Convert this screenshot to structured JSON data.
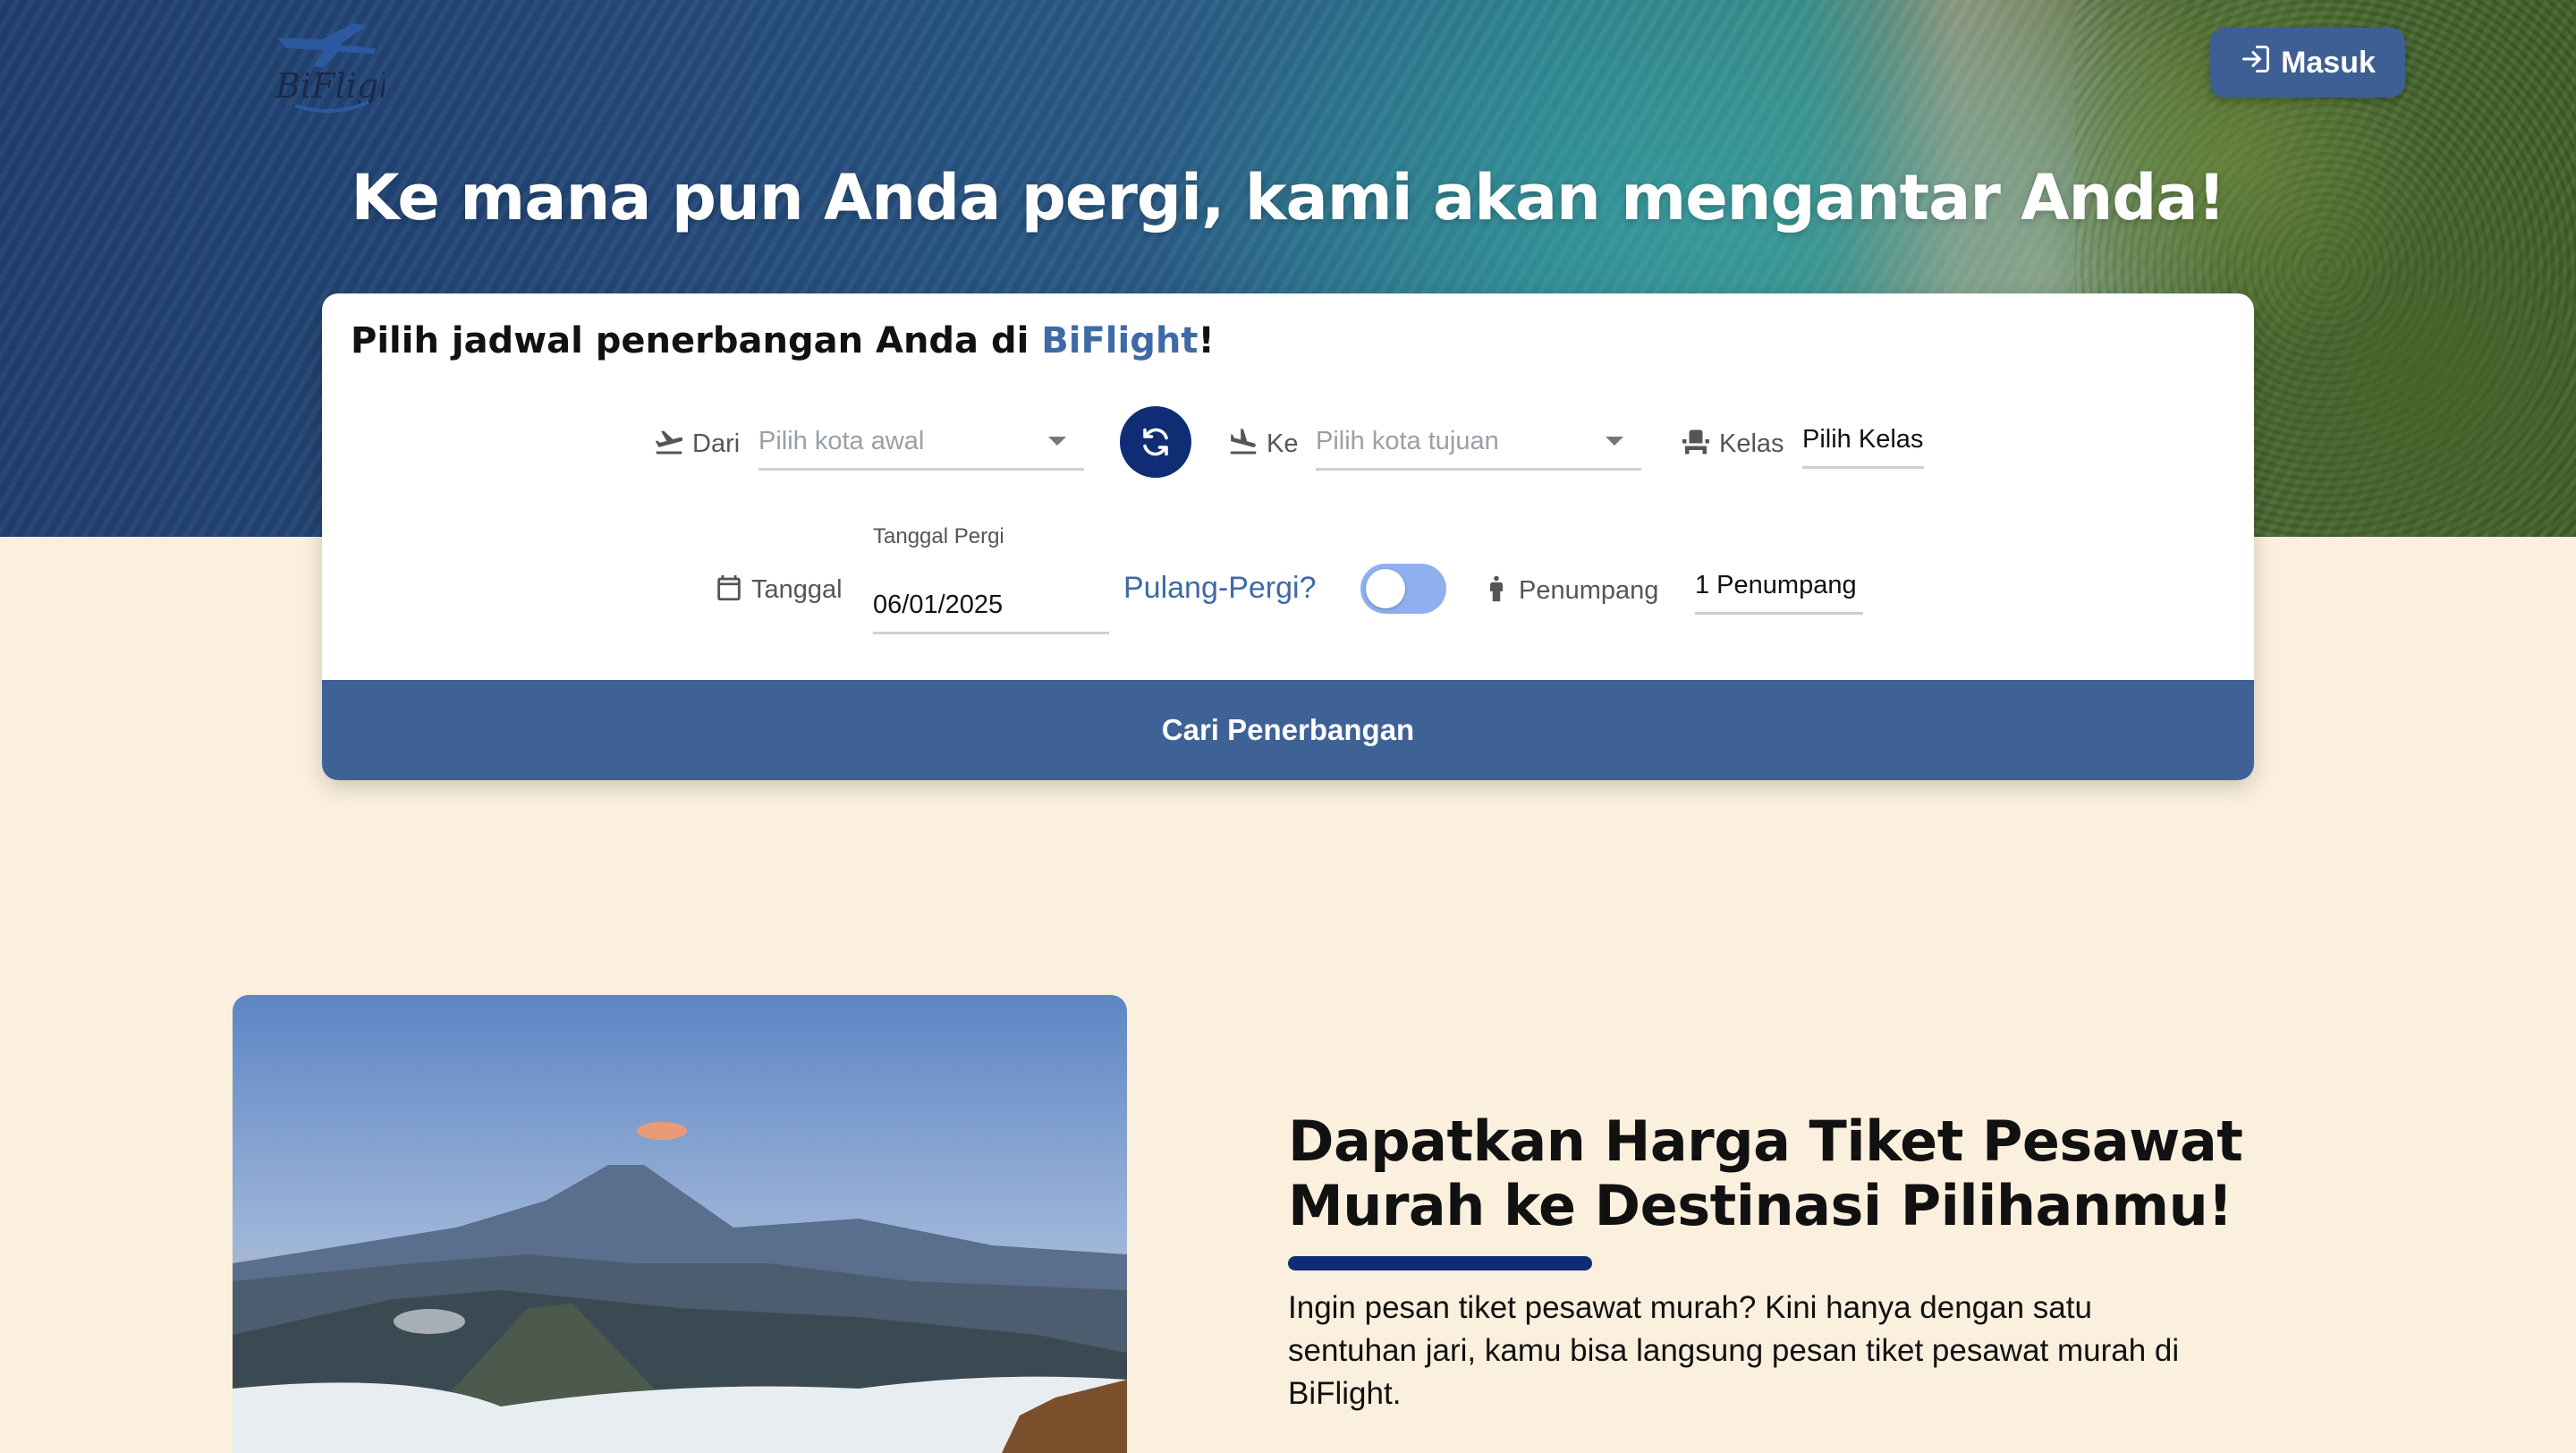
{
  "header": {
    "logo_text": "BiFlight",
    "login_label": "Masuk",
    "hero_title": "Ke mana pun Anda pergi, kami akan mengantar Anda!"
  },
  "search": {
    "title_prefix": "Pilih jadwal penerbangan Anda di ",
    "title_brand": "BiFlight",
    "title_suffix": "!",
    "from_label": "Dari",
    "from_placeholder": "Pilih kota awal",
    "to_label": "Ke",
    "to_placeholder": "Pilih kota tujuan",
    "class_label": "Kelas",
    "class_value": "Pilih Kelas",
    "date_label": "Tanggal",
    "date_field_label": "Tanggal Pergi",
    "date_value": "06/01/2025",
    "roundtrip_label": "Pulang-Pergi?",
    "roundtrip_on": false,
    "passenger_label": "Penumpang",
    "passenger_value": "1 Penumpang",
    "submit_label": "Cari Penerbangan"
  },
  "promo": {
    "title": "Dapatkan Harga Tiket Pesawat Murah ke Destinasi Pilihanmu!",
    "text": "Ingin pesan tiket pesawat murah? Kini hanya dengan satu sentuhan jari, kamu bisa langsung pesan tiket pesawat murah di BiFlight."
  },
  "colors": {
    "brand": "#3e6aa6",
    "primary_dark": "#0f2c74",
    "button": "#3e6296",
    "page_bg": "#fbf0de"
  },
  "icons": [
    "airplane-logo-icon",
    "login-icon",
    "takeoff-icon",
    "swap-icon",
    "landing-icon",
    "seat-icon",
    "calendar-icon",
    "person-icon",
    "chevron-down-icon"
  ]
}
